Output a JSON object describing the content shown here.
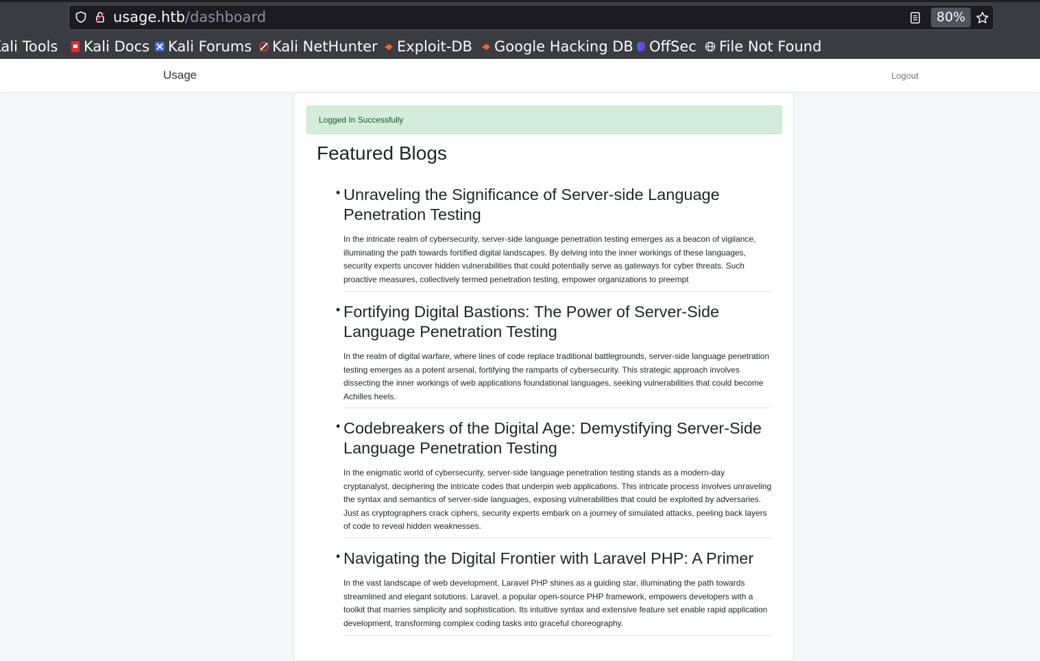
{
  "browser": {
    "url_host": "usage.htb",
    "url_path": "/dashboard",
    "zoom": "80%",
    "bookmarks": [
      {
        "label": "Kali Tools",
        "icon": "kali-icon"
      },
      {
        "label": "Kali Docs",
        "icon": "kali-docs-icon"
      },
      {
        "label": "Kali Forums",
        "icon": "kali-forums-icon"
      },
      {
        "label": "Kali NetHunter",
        "icon": "nethunter-icon"
      },
      {
        "label": "Exploit-DB",
        "icon": "exploitdb-icon"
      },
      {
        "label": "Google Hacking DB",
        "icon": "ghdb-icon"
      },
      {
        "label": "OffSec",
        "icon": "offsec-icon"
      },
      {
        "label": "File Not Found",
        "icon": "globe-icon"
      }
    ]
  },
  "navbar": {
    "brand": "Usage",
    "logout": "Logout"
  },
  "alert": {
    "message": "Logged In Successfully"
  },
  "main": {
    "heading": "Featured Blogs",
    "posts": [
      {
        "title": "Unraveling the Significance of Server-side Language Penetration Testing",
        "body": "In the intricate realm of cybersecurity, server-side language penetration testing emerges as a beacon of vigilance, illuminating the path towards fortified digital landscapes. By delving into the inner workings of these languages, security experts uncover hidden vulnerabilities that could potentially serve as gateways for cyber threats. Such proactive measures, collectively termed penetration testing, empower organizations to preempt"
      },
      {
        "title": "Fortifying Digital Bastions: The Power of Server-Side Language Penetration Testing",
        "body": "In the realm of digital warfare, where lines of code replace traditional battlegrounds, server-side language penetration testing emerges as a potent arsenal, fortifying the ramparts of cybersecurity. This strategic approach involves dissecting the inner workings of web applications foundational languages, seeking vulnerabilities that could become Achilles heels."
      },
      {
        "title": "Codebreakers of the Digital Age: Demystifying Server-Side Language Penetration Testing",
        "body": "In the enigmatic world of cybersecurity, server-side language penetration testing stands as a modern-day cryptanalyst, deciphering the intricate codes that underpin web applications. This intricate process involves unraveling the syntax and semantics of server-side languages, exposing vulnerabilities that could be exploited by adversaries. Just as cryptographers crack ciphers, security experts embark on a journey of simulated attacks, peeling back layers of code to reveal hidden weaknesses."
      },
      {
        "title": "Navigating the Digital Frontier with Laravel PHP: A Primer",
        "body": "In the vast landscape of web development, Laravel PHP shines as a guiding star, illuminating the path towards streamlined and elegant solutions. Laravel, a popular open-source PHP framework, empowers developers with a toolkit that marries simplicity and sophistication. Its intuitive syntax and extensive feature set enable rapid application development, transforming complex coding tasks into graceful choreography."
      }
    ]
  }
}
